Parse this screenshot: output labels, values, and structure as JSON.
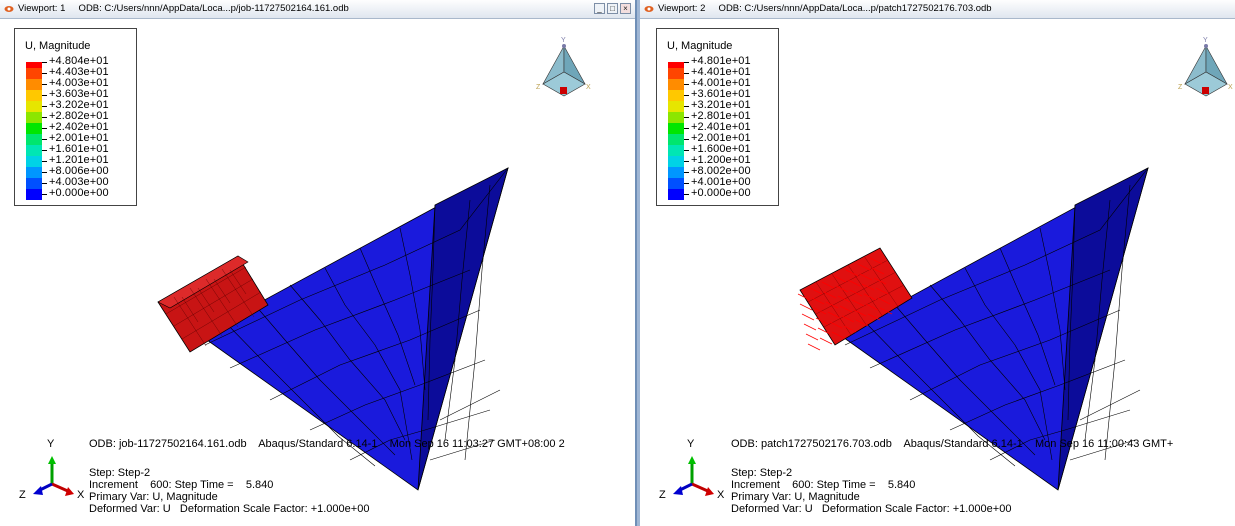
{
  "viewports": [
    {
      "title": "Viewport: 1     ODB: C:/Users/nnn/AppData/Loca...p/job-11727502164.161.odb",
      "window_buttons": [
        "_",
        "□",
        "×"
      ],
      "legend": {
        "title": "U, Magnitude",
        "entries": [
          {
            "value": "+4.804e+01",
            "color": "#ff0000"
          },
          {
            "value": "+4.403e+01",
            "color": "#ff4500"
          },
          {
            "value": "+4.003e+01",
            "color": "#ff8c00"
          },
          {
            "value": "+3.603e+01",
            "color": "#ffc800"
          },
          {
            "value": "+3.202e+01",
            "color": "#e6e600"
          },
          {
            "value": "+2.802e+01",
            "color": "#8ce600"
          },
          {
            "value": "+2.402e+01",
            "color": "#00e600"
          },
          {
            "value": "+2.001e+01",
            "color": "#00e66e"
          },
          {
            "value": "+1.601e+01",
            "color": "#00e6b4"
          },
          {
            "value": "+1.201e+01",
            "color": "#00d2e6"
          },
          {
            "value": "+8.006e+00",
            "color": "#0096ff"
          },
          {
            "value": "+4.003e+00",
            "color": "#0050ff"
          },
          {
            "value": "+0.000e+00",
            "color": "#0000ff"
          }
        ]
      },
      "odb_line": "ODB: job-11727502164.161.odb    Abaqus/Standard 6.14-1    Mon Sep 16 11:03:27 GMT+08:00 2",
      "step": "Step: Step-2",
      "increment": "Increment    600: Step Time =    5.840",
      "primary_var": "Primary Var: U, Magnitude",
      "deformed_var": "Deformed Var: U   Deformation Scale Factor: +1.000e+00"
    },
    {
      "title": "Viewport: 2     ODB: C:/Users/nnn/AppData/Loca...p/patch1727502176.703.odb",
      "legend": {
        "title": "U, Magnitude",
        "entries": [
          {
            "value": "+4.801e+01",
            "color": "#ff0000"
          },
          {
            "value": "+4.401e+01",
            "color": "#ff4500"
          },
          {
            "value": "+4.001e+01",
            "color": "#ff8c00"
          },
          {
            "value": "+3.601e+01",
            "color": "#ffc800"
          },
          {
            "value": "+3.201e+01",
            "color": "#e6e600"
          },
          {
            "value": "+2.801e+01",
            "color": "#8ce600"
          },
          {
            "value": "+2.401e+01",
            "color": "#00e600"
          },
          {
            "value": "+2.001e+01",
            "color": "#00e66e"
          },
          {
            "value": "+1.600e+01",
            "color": "#00e6b4"
          },
          {
            "value": "+1.200e+01",
            "color": "#00d2e6"
          },
          {
            "value": "+8.002e+00",
            "color": "#0096ff"
          },
          {
            "value": "+4.001e+00",
            "color": "#0050ff"
          },
          {
            "value": "+0.000e+00",
            "color": "#0000ff"
          }
        ]
      },
      "odb_line": "ODB: patch1727502176.703.odb    Abaqus/Standard 6.14-1    Mon Sep 16 11:00:43 GMT+",
      "step": "Step: Step-2",
      "increment": "Increment    600: Step Time =    5.840",
      "primary_var": "Primary Var: U, Magnitude",
      "deformed_var": "Deformed Var: U   Deformation Scale Factor: +1.000e+00"
    }
  ],
  "triad_labels": {
    "y": "Y",
    "x": "X",
    "z": "Z"
  },
  "colors": {
    "mesh_blue": "#1a1adc",
    "mesh_blue_dark": "#0c0c9a",
    "mesh_red": "#c81414",
    "arrow_red": "#ff0000",
    "titlebar_border": "#6f8fb7"
  }
}
